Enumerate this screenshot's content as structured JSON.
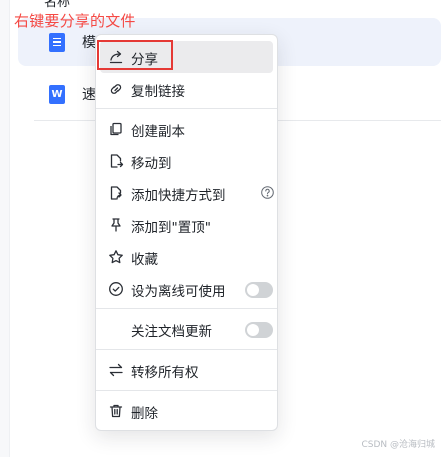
{
  "header": {
    "fragment": "名称"
  },
  "annotation": {
    "text": "右键要分享的文件"
  },
  "files": [
    {
      "name": "模",
      "type": "doc"
    },
    {
      "name": "速",
      "type": "word",
      "badge": "W"
    }
  ],
  "menu": {
    "share": "分享",
    "copy_link": "复制链接",
    "create_copy": "创建副本",
    "move_to": "移动到",
    "add_shortcut": "添加快捷方式到",
    "pin_top": "添加到\"置顶\"",
    "favorite": "收藏",
    "offline": "设为离线可使用",
    "follow_updates": "关注文档更新",
    "transfer_owner": "转移所有权",
    "delete": "删除"
  },
  "state": {
    "offline_enabled": false,
    "follow_updates_enabled": false
  },
  "colors": {
    "annotation": "#f54a45",
    "highlight": "#e53935",
    "doc_blue": "#3370ff"
  },
  "watermark": "CSDN @沧海归城"
}
